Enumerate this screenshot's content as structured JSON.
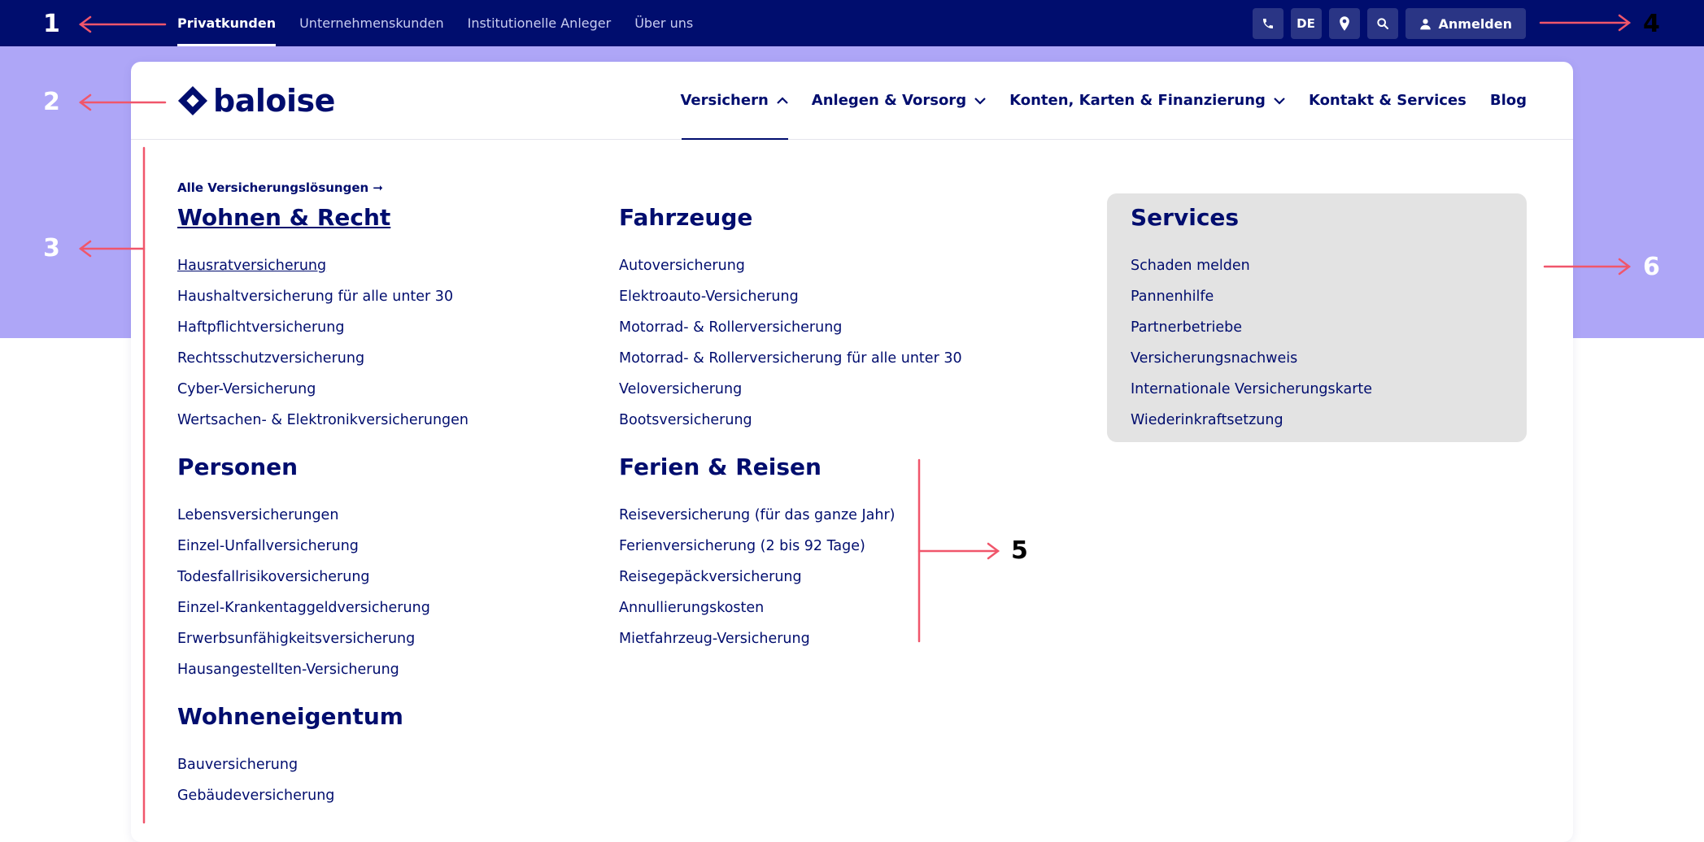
{
  "topnav": {
    "items": [
      "Privatkunden",
      "Unternehmenskunden",
      "Institutionelle Anleger",
      "Über uns"
    ]
  },
  "utilities": {
    "language": "DE",
    "login_label": "Anmelden",
    "icons": [
      "phone-icon",
      "location-pin-icon",
      "search-icon",
      "user-icon"
    ]
  },
  "brand": {
    "name": "baloise",
    "colors": {
      "navy": "#000d6e",
      "lilac": "#aea6f7",
      "services_bg": "#e3e3e3",
      "annotation": "#f0566b"
    }
  },
  "mainnav": {
    "items": [
      {
        "label": "Versichern",
        "chevron": "up"
      },
      {
        "label": "Anlegen & Vorsorg",
        "chevron": "down"
      },
      {
        "label": "Konten, Karten & Finanzierung",
        "chevron": "down"
      },
      {
        "label": "Kontakt & Services",
        "chevron": ""
      },
      {
        "label": "Blog",
        "chevron": ""
      }
    ]
  },
  "menu": {
    "all_link": "Alle Versicherungslösungen ➞",
    "sections": {
      "wohnen": {
        "title": "Wohnen & Recht",
        "items": [
          "Hausratversicherung",
          "Haushaltversicherung für alle unter 30",
          "Haftpflichtversicherung",
          "Rechtsschutzversicherung",
          "Cyber-Versicherung",
          "Wertsachen- & Elektronikversicherungen"
        ]
      },
      "personen": {
        "title": "Personen",
        "items": [
          "Lebensversicherungen",
          "Einzel-Unfallversicherung",
          "Todesfallrisikoversicherung",
          "Einzel-Krankentaggeldversicherung",
          "Erwerbsunfähigkeitsversicherung",
          "Hausangestellten-Versicherung"
        ]
      },
      "wohneigentum": {
        "title": "Wohneneigentum",
        "items": [
          "Bauversicherung",
          "Gebäudeversicherung"
        ]
      },
      "fahrzeuge": {
        "title": "Fahrzeuge",
        "items": [
          "Autoversicherung",
          "Elektroauto-Versicherung",
          "Motorrad- & Rollerversicherung",
          "Motorrad- & Rollerversicherung für alle unter 30",
          "Veloversicherung",
          "Bootsversicherung"
        ]
      },
      "ferien": {
        "title": "Ferien & Reisen",
        "items": [
          "Reiseversicherung (für das ganze Jahr)",
          "Ferienversicherung (2 bis 92 Tage)",
          "Reisegepäckversicherung",
          "Annullierungskosten",
          "Mietfahrzeug-Versicherung"
        ]
      },
      "services": {
        "title": "Services",
        "items": [
          "Schaden melden",
          "Pannenhilfe",
          "Partnerbetriebe",
          "Versicherungsnachweis",
          "Internationale Versicherungskarte",
          "Wiederinkraftsetzung"
        ]
      }
    }
  },
  "annotations": [
    "1",
    "2",
    "3",
    "4",
    "5",
    "6"
  ]
}
